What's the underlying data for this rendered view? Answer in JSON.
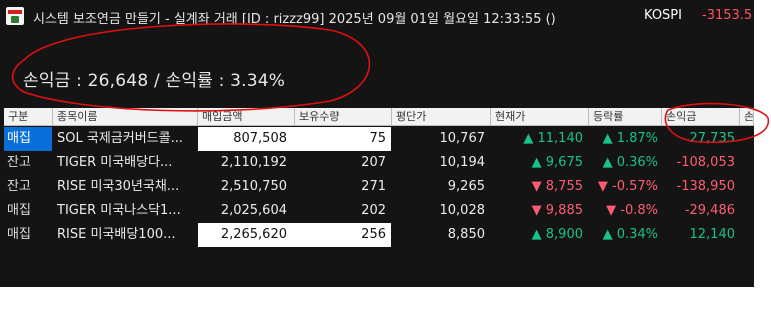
{
  "window": {
    "title": "시스템 보조연금 만들기 - 실계좌 거래 [ID : rizzz99] 2025년 09월 01일 월요일 12:33:55 ()",
    "kospi_label": "KOSPI",
    "kospi_value": "-3153.5"
  },
  "summary": {
    "text": "손익금 : 26,648  /  손익률 : 3.34%"
  },
  "table": {
    "headers": [
      "구분",
      "종목이름",
      "매입금액",
      "보유수량",
      "평단가",
      "현재가",
      "등락률",
      "손익금",
      "손"
    ],
    "rows": [
      {
        "type": "매집",
        "name": "SOL 국제금커버드콜...",
        "buy": "807,508",
        "qty": "75",
        "avg": "10,767",
        "cur": "▲ 11,140",
        "rate": "▲ 1.87%",
        "pnl": "27,735",
        "dir": "up",
        "pnl_dir": "up",
        "selected": true,
        "white_buy": true,
        "white_qty": true
      },
      {
        "type": "잔고",
        "name": "TIGER 미국배당다...",
        "buy": "2,110,192",
        "qty": "207",
        "avg": "10,194",
        "cur": "▲ 9,675",
        "rate": "▲ 0.36%",
        "pnl": "-108,053",
        "dir": "up",
        "pnl_dir": "down",
        "selected": false,
        "white_buy": false,
        "white_qty": false
      },
      {
        "type": "잔고",
        "name": "RISE 미국30년국채...",
        "buy": "2,510,750",
        "qty": "271",
        "avg": "9,265",
        "cur": "▼ 8,755",
        "rate": "▼ -0.57%",
        "pnl": "-138,950",
        "dir": "down",
        "pnl_dir": "down",
        "selected": false,
        "white_buy": false,
        "white_qty": false
      },
      {
        "type": "매집",
        "name": "TIGER 미국나스닥1...",
        "buy": "2,025,604",
        "qty": "202",
        "avg": "10,028",
        "cur": "▼ 9,885",
        "rate": "▼ -0.8%",
        "pnl": "-29,486",
        "dir": "down",
        "pnl_dir": "down",
        "selected": false,
        "white_buy": false,
        "white_qty": false
      },
      {
        "type": "매집",
        "name": "RISE 미국배당100...",
        "buy": "2,265,620",
        "qty": "256",
        "avg": "8,850",
        "cur": "▲ 8,900",
        "rate": "▲ 0.34%",
        "pnl": "12,140",
        "dir": "up",
        "pnl_dir": "up",
        "selected": false,
        "white_buy": true,
        "white_qty": true
      }
    ]
  },
  "colors": {
    "up": "#19c28a",
    "down": "#ff5c73",
    "selection": "#0a6fd8",
    "annotation": "#e01010"
  }
}
